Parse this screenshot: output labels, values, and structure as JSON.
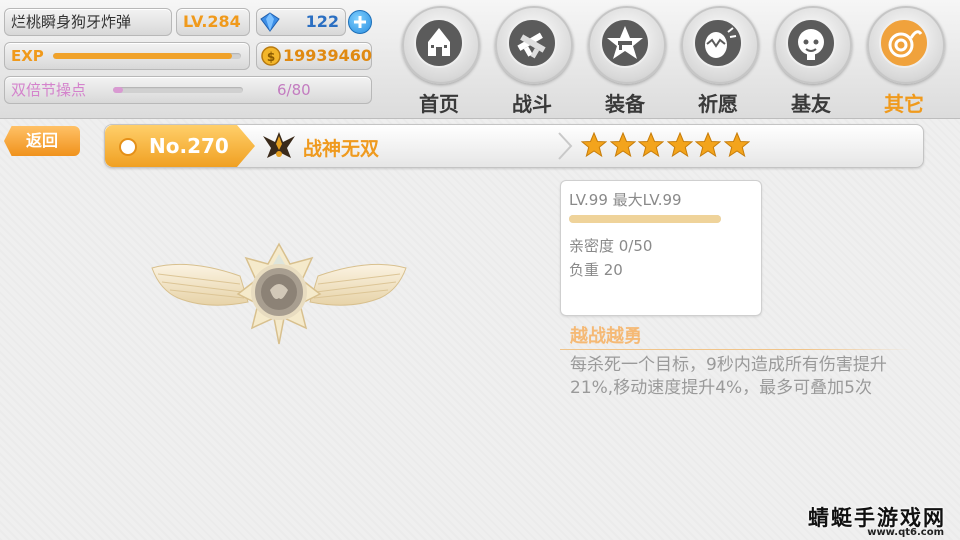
{
  "player": {
    "name": "烂桃瞬身狗牙炸弹",
    "level": "LV.284",
    "gems": "122",
    "exp_label": "EXP",
    "exp_progress": 0.95,
    "coins": "19939460",
    "event_label": "双倍节操点",
    "event_value": "6/80",
    "event_progress": 0.075
  },
  "nav": [
    {
      "label": "首页",
      "icon": "castle-icon"
    },
    {
      "label": "战斗",
      "icon": "crossed-guns-icon"
    },
    {
      "label": "装备",
      "icon": "star-gun-icon"
    },
    {
      "label": "祈愿",
      "icon": "wish-egg-icon"
    },
    {
      "label": "基友",
      "icon": "friend-face-icon"
    },
    {
      "label": "其它",
      "icon": "other-swirl-icon",
      "active": true
    }
  ],
  "titlebar": {
    "back_label": "返回",
    "number": "No.270",
    "item_name": "战神无双",
    "stars": 6
  },
  "stats": {
    "level_line": "LV.99 最大LV.99",
    "level_progress": 1.0,
    "intimacy": "亲密度 0/50",
    "weight": "负重 20"
  },
  "skill": {
    "title": "越战越勇",
    "description": "每杀死一个目标，9秒内造成所有伤害提升21%,移动速度提升4%，最多可叠加5次"
  },
  "watermark": {
    "text": "蜻蜓手游戏网",
    "url": "www.qt6.com"
  },
  "colors": {
    "accent": "#f09a1c",
    "exp_bar": "#f0a22a",
    "event_bar": "#d99ad2",
    "star": "#f3a41c"
  }
}
